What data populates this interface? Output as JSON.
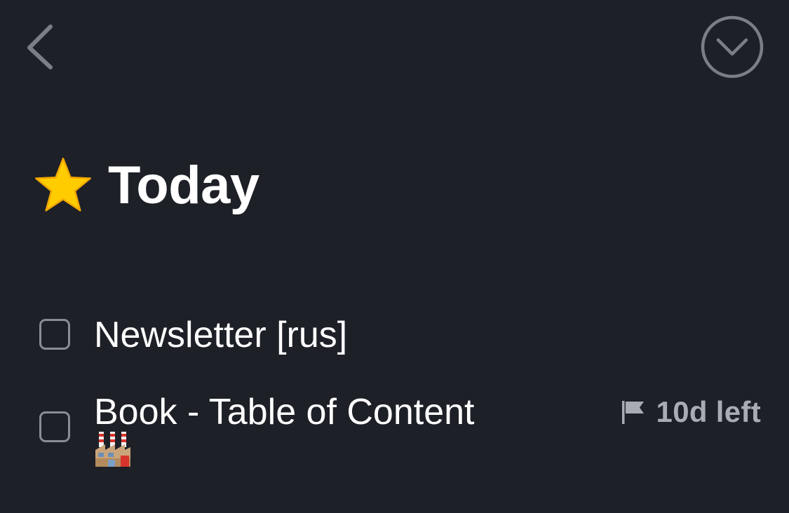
{
  "header": {
    "back_icon": "chevron-left-icon",
    "menu_icon": "chevron-down-circle-icon"
  },
  "page": {
    "title_icon": "star-icon",
    "title": "Today"
  },
  "tasks": [
    {
      "title": "Newsletter [rus]",
      "checked": false
    },
    {
      "title": "Book - Table of Content",
      "tag_icon": "factory-icon",
      "deadline_icon": "flag-icon",
      "deadline": "10d left",
      "checked": false
    }
  ],
  "colors": {
    "background": "#1e2028",
    "text": "#ffffff",
    "muted": "#8a8d96",
    "deadline": "#a9acb4",
    "star": "#ffcc00"
  }
}
